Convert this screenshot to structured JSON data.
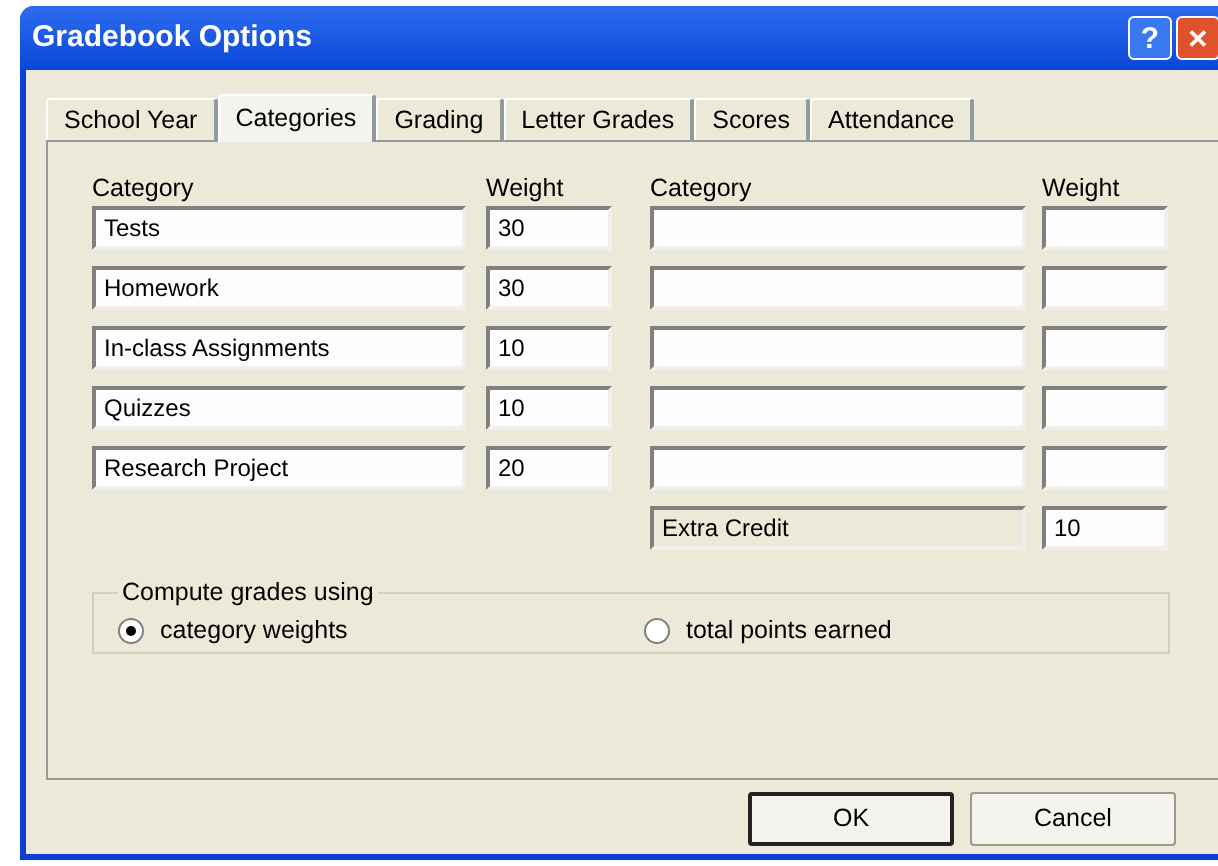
{
  "window": {
    "title": "Gradebook Options",
    "help_button": "?",
    "close_button": "✕"
  },
  "tabs": [
    {
      "label": "School Year",
      "selected": false
    },
    {
      "label": "Categories",
      "selected": true
    },
    {
      "label": "Grading",
      "selected": false
    },
    {
      "label": "Letter Grades",
      "selected": false
    },
    {
      "label": "Scores",
      "selected": false
    },
    {
      "label": "Attendance",
      "selected": false
    }
  ],
  "columns": {
    "left_category": "Category",
    "left_weight": "Weight",
    "right_category": "Category",
    "right_weight": "Weight"
  },
  "categories": [
    {
      "name": "Tests",
      "weight": "30"
    },
    {
      "name": "Homework",
      "weight": "30"
    },
    {
      "name": "In-class Assignments",
      "weight": "10"
    },
    {
      "name": "Quizzes",
      "weight": "10"
    },
    {
      "name": "Research Project",
      "weight": "20"
    }
  ],
  "extra_credit": {
    "label": "Extra Credit",
    "weight": "10"
  },
  "compute": {
    "legend": "Compute grades using",
    "options": [
      {
        "label": "category weights",
        "selected": true
      },
      {
        "label": "total points earned",
        "selected": false
      }
    ]
  },
  "buttons": [
    {
      "label": "OK",
      "default": true
    },
    {
      "label": "Cancel",
      "default": false
    }
  ]
}
